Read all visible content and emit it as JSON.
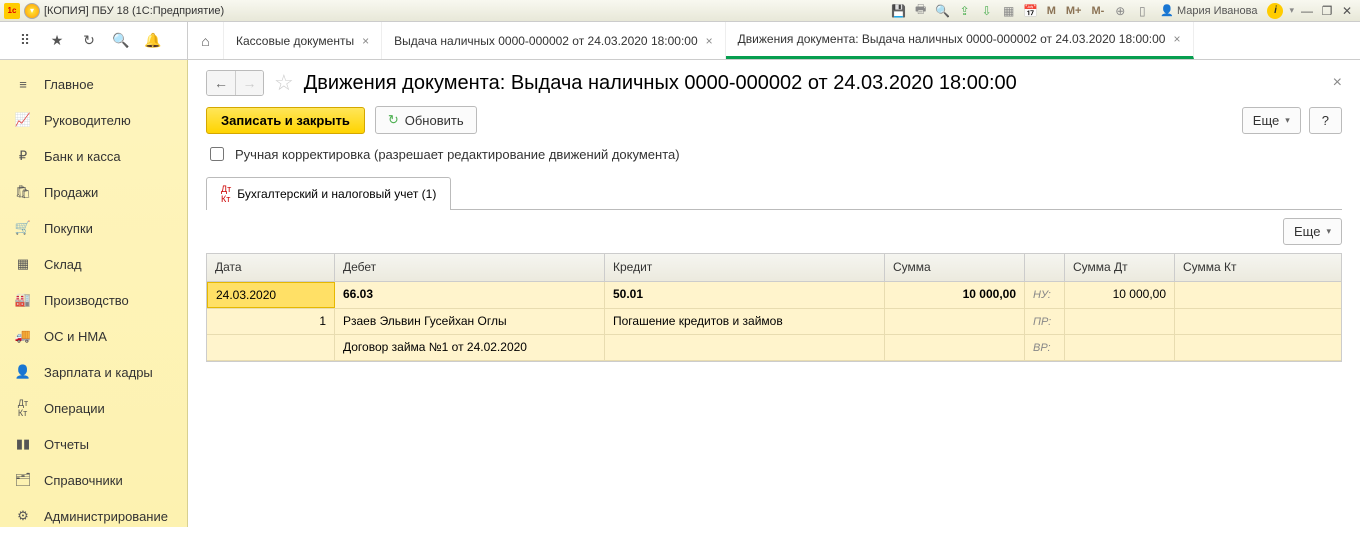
{
  "titlebar": {
    "title": "[КОПИЯ] ПБУ 18  (1С:Предприятие)",
    "m1": "M",
    "m2": "M+",
    "m3": "M-",
    "user": "Мария Иванова"
  },
  "tabs": {
    "t1": "Кассовые документы",
    "t2": "Выдача наличных 0000-000002 от 24.03.2020 18:00:00",
    "t3": "Движения документа: Выдача наличных 0000-000002 от 24.03.2020 18:00:00"
  },
  "sidebar": {
    "items": [
      {
        "label": "Главное"
      },
      {
        "label": "Руководителю"
      },
      {
        "label": "Банк и касса"
      },
      {
        "label": "Продажи"
      },
      {
        "label": "Покупки"
      },
      {
        "label": "Склад"
      },
      {
        "label": "Производство"
      },
      {
        "label": "ОС и НМА"
      },
      {
        "label": "Зарплата и кадры"
      },
      {
        "label": "Операции"
      },
      {
        "label": "Отчеты"
      },
      {
        "label": "Справочники"
      },
      {
        "label": "Администрирование"
      }
    ]
  },
  "page": {
    "title": "Движения документа: Выдача наличных 0000-000002 от 24.03.2020 18:00:00",
    "save_close": "Записать и закрыть",
    "refresh": "Обновить",
    "more": "Еще",
    "help": "?",
    "manual_edit": "Ручная корректировка (разрешает редактирование движений документа)",
    "subtab": "Бухгалтерский и налоговый учет (1)"
  },
  "grid": {
    "head": {
      "date": "Дата",
      "debit": "Дебет",
      "credit": "Кредит",
      "sum": "Сумма",
      "sumdt": "Сумма Дт",
      "sumkt": "Сумма Кт"
    },
    "r1": {
      "date": "24.03.2020",
      "debit": "66.03",
      "credit": "50.01",
      "sum": "10 000,00",
      "nu": "НУ:",
      "sumdt": "10 000,00"
    },
    "r2": {
      "num": "1",
      "debit": "Рзаев Эльвин Гусейхан Оглы",
      "credit": "Погашение кредитов и займов",
      "pr": "ПР:"
    },
    "r3": {
      "debit": "Договор займа №1 от 24.02.2020",
      "vr": "ВР:"
    }
  }
}
